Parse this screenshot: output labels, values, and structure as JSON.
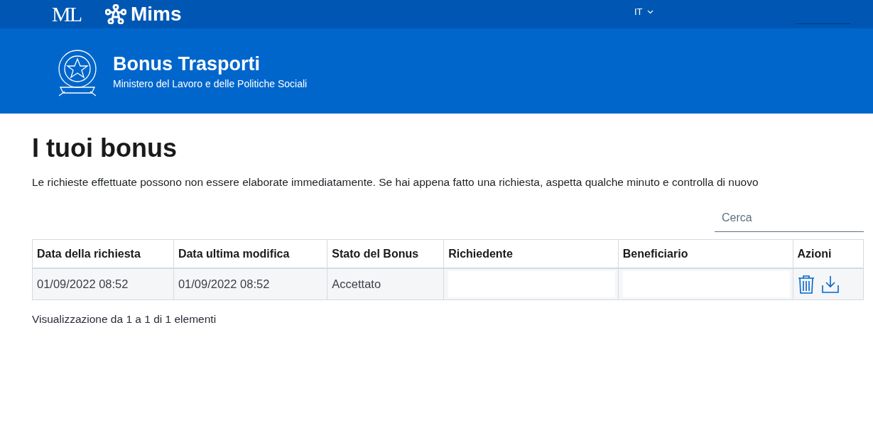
{
  "top_bar": {
    "brand_mark": "ML",
    "brand": "Mims",
    "language": "IT"
  },
  "header": {
    "title": "Bonus Trasporti",
    "subtitle": "Ministero del Lavoro e delle Politiche Sociali"
  },
  "page": {
    "title": "I tuoi bonus",
    "notice": "Le richieste effettuate possono non essere elaborate immediatamente. Se hai appena fatto una richiesta, aspetta qualche minuto e controlla di nuovo"
  },
  "search": {
    "placeholder": "Cerca"
  },
  "table": {
    "columns": [
      "Data della richiesta",
      "Data ultima modifica",
      "Stato del Bonus",
      "Richiedente",
      "Beneficiario",
      "Azioni"
    ],
    "rows": [
      {
        "cells": [
          {
            "kind": "text",
            "text": "01/09/2022 08:52"
          },
          {
            "kind": "text",
            "text": "01/09/2022 08:52"
          },
          {
            "kind": "text",
            "text": "Accettato"
          },
          {
            "kind": "redacted"
          },
          {
            "kind": "redacted"
          },
          {
            "kind": "actions"
          }
        ]
      }
    ]
  },
  "footer_info": "Visualizzazione da 1 a 1 di 1 elementi"
}
